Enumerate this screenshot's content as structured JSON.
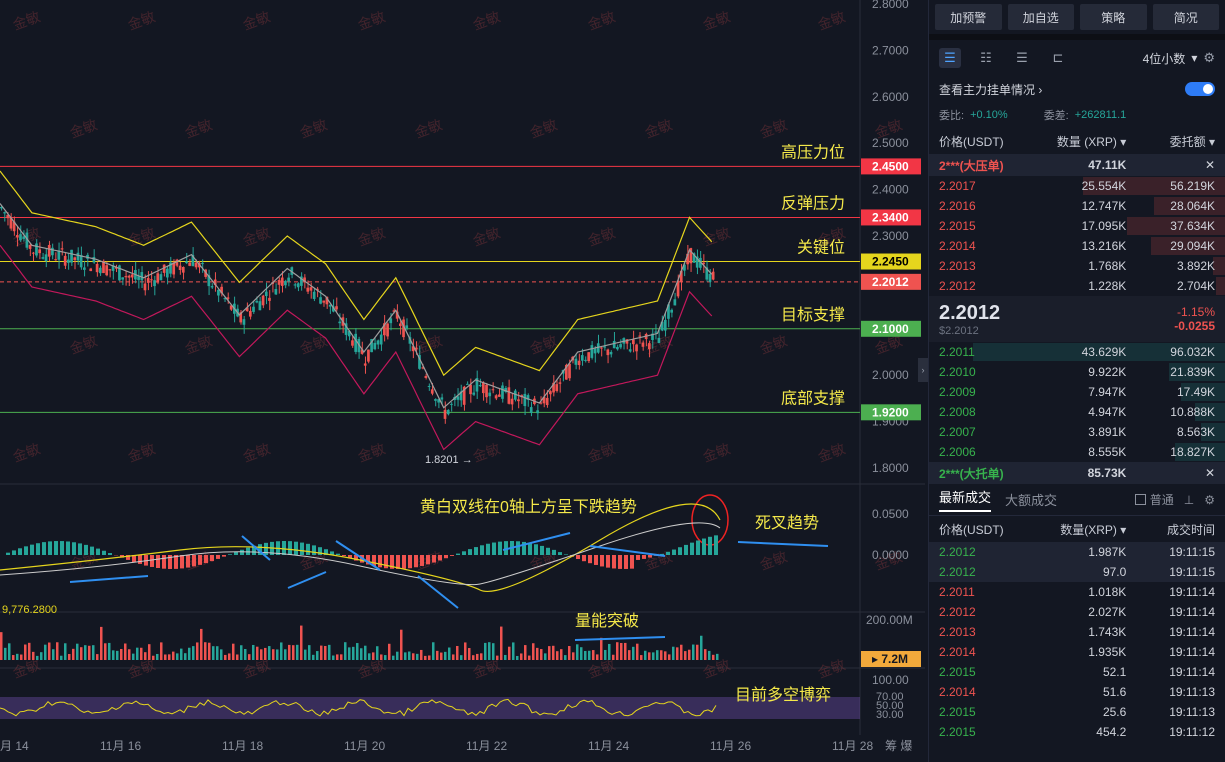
{
  "chart": {
    "price_axis": [
      "2.8000",
      "2.7000",
      "2.6000",
      "2.5000",
      "2.4000",
      "2.3000",
      "2.2000",
      "2.1000",
      "2.0000",
      "1.9000",
      "1.8000"
    ],
    "date_axis": [
      "月 14",
      "11月 16",
      "11月 18",
      "11月 20",
      "11月 22",
      "11月 24",
      "11月 26",
      "11月 28"
    ],
    "axis_end_label": "筹 爆",
    "levels": [
      {
        "label": "高压力位",
        "value": "2.4500",
        "color": "#f23645"
      },
      {
        "label": "反弹压力",
        "value": "2.3400",
        "color": "#f23645"
      },
      {
        "label": "关键位",
        "value": "2.2450",
        "color": "#e5d51d"
      },
      {
        "label": "",
        "value": "2.2012",
        "color": "#ef5350"
      },
      {
        "label": "目标支撑",
        "value": "2.1000",
        "color": "#4caf50"
      },
      {
        "label": "底部支撑",
        "value": "1.9200",
        "color": "#4caf50"
      }
    ],
    "low_marker": "1.8201",
    "watermark": "金敏",
    "macd_axis": [
      "0.0500",
      "0.0000"
    ],
    "macd_label": "9,776.2800",
    "macd_note": "黄白双线在0轴上方呈下跌趋势",
    "macd_note2": "死叉趋势",
    "volume_axis": "200.00M",
    "volume_value": "7.2M",
    "volume_note": "量能突破",
    "rsi_axis": [
      "100.00",
      "70.00",
      "50.00",
      "30.00"
    ],
    "rsi_note": "目前多空博弈"
  },
  "side": {
    "buttons": [
      "加预警",
      "加自选",
      "策略",
      "简况"
    ],
    "decimals": "4位小数",
    "link_text": "查看主力挂单情况",
    "ratio_label": "委比:",
    "ratio_value": "+0.10%",
    "diff_label": "委差:",
    "diff_value": "+262811.1",
    "book_headers": [
      "价格(USDT)",
      "数量 (XRP)",
      "委托额"
    ],
    "big_ask": {
      "price": "2***(大压单)",
      "qty": "47.11K"
    },
    "asks": [
      {
        "price": "2.2017",
        "qty": "25.554K",
        "amt": "56.219K",
        "depth": 0.48
      },
      {
        "price": "2.2016",
        "qty": "12.747K",
        "amt": "28.064K",
        "depth": 0.24
      },
      {
        "price": "2.2015",
        "qty": "17.095K",
        "amt": "37.634K",
        "depth": 0.33
      },
      {
        "price": "2.2014",
        "qty": "13.216K",
        "amt": "29.094K",
        "depth": 0.25
      },
      {
        "price": "2.2013",
        "qty": "1.768K",
        "amt": "3.892K",
        "depth": 0.04
      },
      {
        "price": "2.2012",
        "qty": "1.228K",
        "amt": "2.704K",
        "depth": 0.03
      }
    ],
    "last_price": "2.2012",
    "last_price_usd": "$2.2012",
    "change_pct": "-1.15%",
    "change_abs": "-0.0255",
    "bids": [
      {
        "price": "2.2011",
        "qty": "43.629K",
        "amt": "96.032K",
        "depth": 0.85
      },
      {
        "price": "2.2010",
        "qty": "9.922K",
        "amt": "21.839K",
        "depth": 0.19
      },
      {
        "price": "2.2009",
        "qty": "7.947K",
        "amt": "17.49K",
        "depth": 0.15
      },
      {
        "price": "2.2008",
        "qty": "4.947K",
        "amt": "10.888K",
        "depth": 0.1
      },
      {
        "price": "2.2007",
        "qty": "3.891K",
        "amt": "8.563K",
        "depth": 0.08
      },
      {
        "price": "2.2006",
        "qty": "8.555K",
        "amt": "18.827K",
        "depth": 0.17
      }
    ],
    "big_bid": {
      "price": "2***(大托单)",
      "qty": "85.73K"
    },
    "tab_latest": "最新成交",
    "tab_large": "大额成交",
    "normal_label": "普通",
    "trade_headers": [
      "价格(USDT)",
      "数量(XRP)",
      "成交时间"
    ],
    "trades": [
      {
        "price": "2.2012",
        "qty": "1.987K",
        "time": "19:11:15",
        "side": "buy",
        "hl": true
      },
      {
        "price": "2.2012",
        "qty": "97.0",
        "time": "19:11:15",
        "side": "buy",
        "hl": true
      },
      {
        "price": "2.2011",
        "qty": "1.018K",
        "time": "19:11:14",
        "side": "sell",
        "hl": false
      },
      {
        "price": "2.2012",
        "qty": "2.027K",
        "time": "19:11:14",
        "side": "sell",
        "hl": false
      },
      {
        "price": "2.2013",
        "qty": "1.743K",
        "time": "19:11:14",
        "side": "sell",
        "hl": false
      },
      {
        "price": "2.2014",
        "qty": "1.935K",
        "time": "19:11:14",
        "side": "sell",
        "hl": false
      },
      {
        "price": "2.2015",
        "qty": "52.1",
        "time": "19:11:14",
        "side": "buy",
        "hl": false
      },
      {
        "price": "2.2014",
        "qty": "51.6",
        "time": "19:11:13",
        "side": "sell",
        "hl": false
      },
      {
        "price": "2.2015",
        "qty": "25.6",
        "time": "19:11:13",
        "side": "buy",
        "hl": false
      },
      {
        "price": "2.2015",
        "qty": "454.2",
        "time": "19:11:12",
        "side": "buy",
        "hl": false
      }
    ]
  }
}
